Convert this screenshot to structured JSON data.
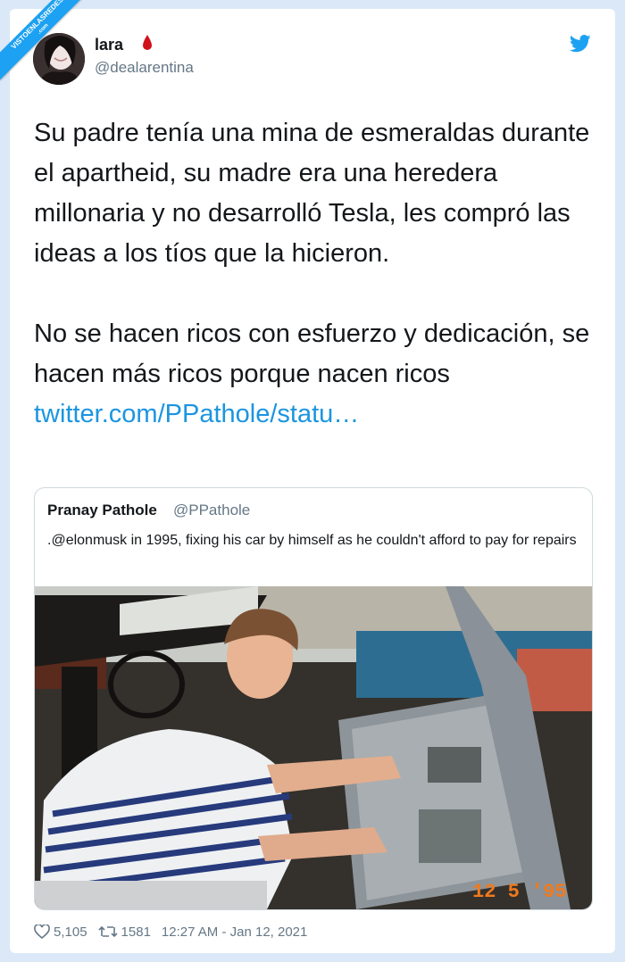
{
  "watermark": {
    "line1": "VISTOENLASREDES",
    "line2": ".com"
  },
  "author": {
    "name": "lara",
    "handle": "@dealarentina"
  },
  "tweet": {
    "paragraph1": "Su padre tenía una mina de esmeraldas durante el apartheid, su madre era una heredera millonaria y no desarrolló Tesla, les compró las ideas a los tíos que la hicieron.",
    "paragraph2": "No se hacen ricos con esfuerzo y dedicación, se hacen más ricos porque nacen ricos",
    "link": "twitter.com/PPathole/statu…"
  },
  "quoted": {
    "name": "Pranay Pathole",
    "handle": "@PPathole",
    "text": ".@elonmusk in 1995, fixing his car by himself as he couldn't afford to pay for repairs",
    "photo_date_stamp": "12  5 '95"
  },
  "stats": {
    "likes": "5,105",
    "retweets": "1581",
    "timestamp": "12:27 AM - Jan 12, 2021"
  },
  "icons": [
    "blood-drop-icon",
    "twitter-bird-icon",
    "heart-icon",
    "retweet-icon"
  ],
  "colors": {
    "accent": "#1da1f2",
    "link": "#1b95e0",
    "text": "#14171a",
    "muted": "#657786",
    "background": "#dbe8f7",
    "stamp": "#f07a1e"
  }
}
